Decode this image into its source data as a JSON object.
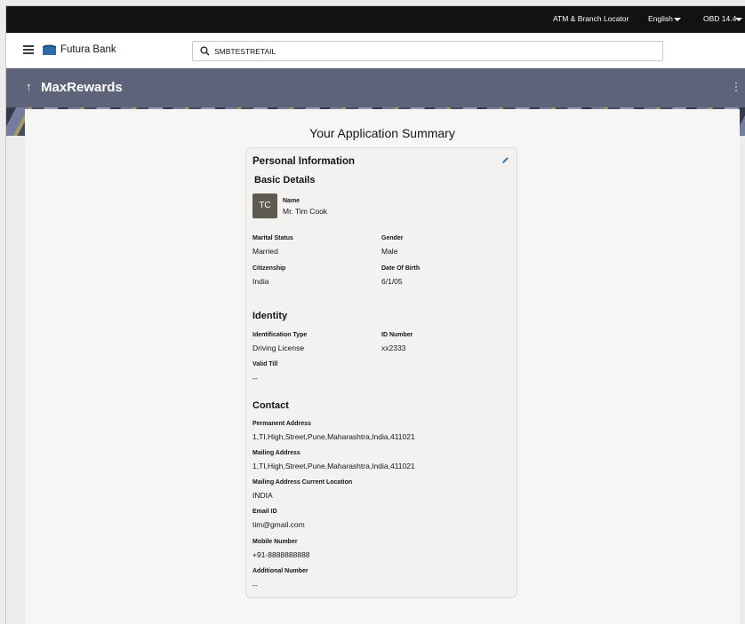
{
  "topbar": {
    "atm_locator": "ATM & Branch Locator",
    "language": "English",
    "user": "OBD 14.4"
  },
  "header": {
    "brand": "Futura Bank",
    "search_value": "SMBTESTRETAIL"
  },
  "banner": {
    "back_glyph": "↑",
    "title": "MaxRewards"
  },
  "page": {
    "title": "Your Application Summary"
  },
  "personal": {
    "section_title": "Personal Information",
    "basic_details": {
      "heading": "Basic Details",
      "avatar_initials": "TC",
      "name_label": "Name",
      "name_value": "Mr. Tim Cook",
      "marital_label": "Marital Status",
      "marital_value": "Married",
      "gender_label": "Gender",
      "gender_value": "Male",
      "citizenship_label": "Citizenship",
      "citizenship_value": "India",
      "dob_label": "Date Of Birth",
      "dob_value": "6/1/05"
    },
    "identity": {
      "heading": "Identity",
      "id_type_label": "Identification Type",
      "id_type_value": "Driving License",
      "id_number_label": "ID Number",
      "id_number_value": "xx2333",
      "valid_till_label": "Valid Till",
      "valid_till_value": "--"
    },
    "contact": {
      "heading": "Contact",
      "permanent_label": "Permanent Address",
      "permanent_value": "1,TI,High,Street,Pune,Maharashtra,India,411021",
      "mailing_label": "Mailing Address",
      "mailing_value": "1,TI,High,Street,Pune,Maharashtra,India,411021",
      "mailing_location_label": "Mailing Address Current Location",
      "mailing_location_value": "INDIA",
      "email_label": "Email ID",
      "email_value": "tim@gmail.com",
      "mobile_label": "Mobile Number",
      "mobile_value": "+91-8888888888",
      "additional_label": "Additional Number",
      "additional_value": "--"
    }
  },
  "icons": {
    "menu": "hamburger-menu-icon",
    "logo": "futura-bank-logo-icon",
    "search": "search-icon",
    "edit": "pencil-edit-icon",
    "dropdown": "caret-down-icon",
    "more": "kebab-menu-icon"
  },
  "colors": {
    "topbar": "#121212",
    "banner": "#5d6378",
    "logo": "#2e6ca6",
    "edit_icon": "#3a6ea5"
  }
}
